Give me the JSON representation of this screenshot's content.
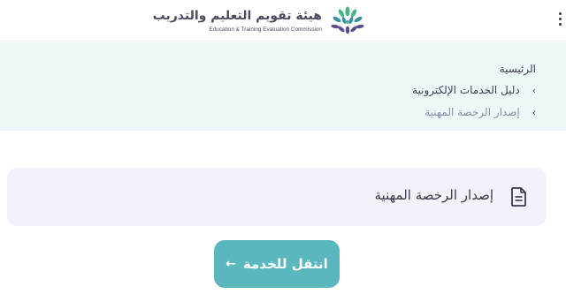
{
  "header": {
    "logo_ar": "هيئة تقويم التعليم والتدريب",
    "logo_en": "Education & Training Evaluation Commission",
    "logo_icon": "leaf-cluster-logo",
    "menu_icon": "kebab-menu-icon"
  },
  "breadcrumb": {
    "home": "الرئيسية",
    "items": [
      {
        "label": "دليل الخدمات الإلكترونية",
        "chevron": "›"
      },
      {
        "label": "إصدار الرخصة المهنية",
        "chevron": "›"
      }
    ]
  },
  "service": {
    "title": "إصدار الرخصة المهنية",
    "icon": "document-icon"
  },
  "cta": {
    "label": "انتقل للخدمة",
    "arrow": "←"
  },
  "colors": {
    "accent": "#5ab7bd",
    "breadcrumb_bg": "#eef7f8",
    "card_bg": "#f2f2fa",
    "logo_green": "#4bb58a",
    "logo_teal": "#3b8ea5",
    "logo_purple": "#5a4f8e"
  }
}
